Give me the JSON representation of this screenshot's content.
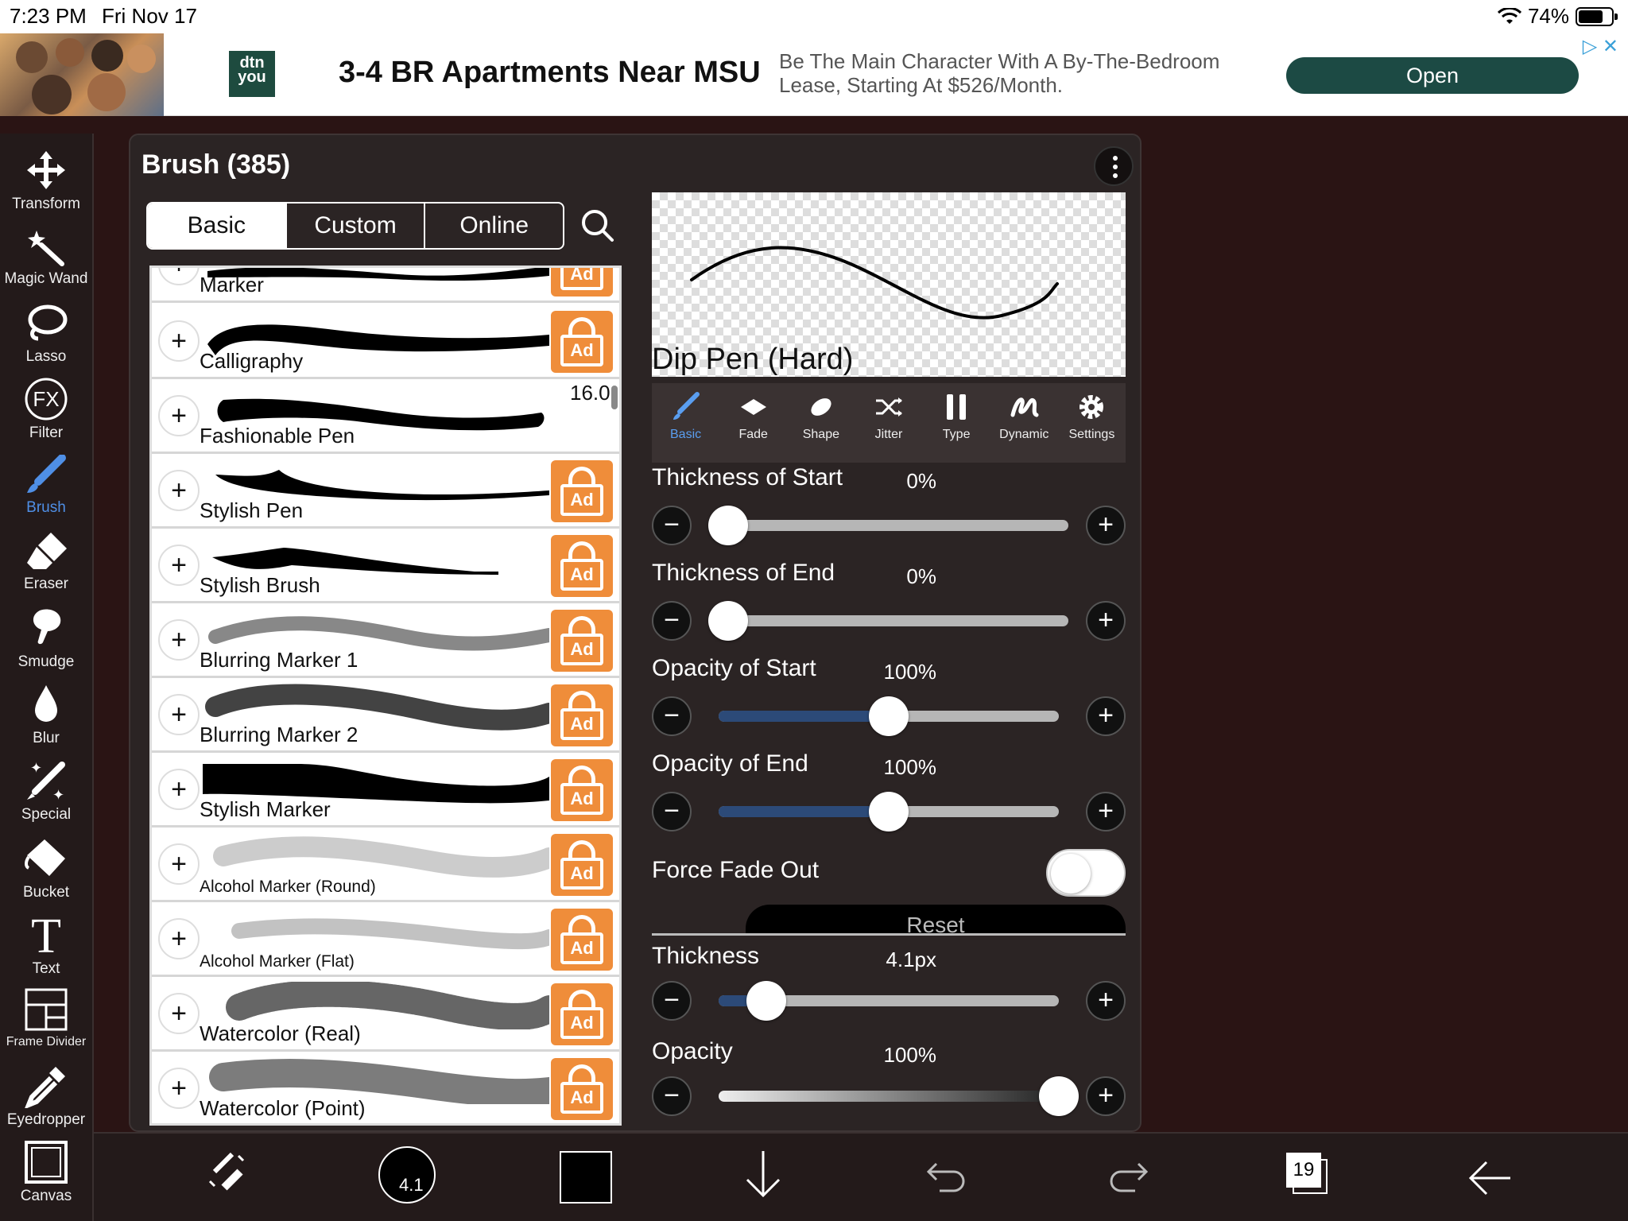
{
  "status": {
    "time": "7:23 PM",
    "date": "Fri Nov 17",
    "battery": "74%"
  },
  "ad": {
    "logo": "dtn you",
    "title": "3-4 BR Apartments Near MSU",
    "description": "Be The Main Character With A By-The-Bedroom Lease, Starting At $526/Month.",
    "button": "Open"
  },
  "tools": [
    {
      "label": "Transform",
      "icon": "move-icon"
    },
    {
      "label": "Magic Wand",
      "icon": "magic-wand-icon"
    },
    {
      "label": "Lasso",
      "icon": "lasso-icon"
    },
    {
      "label": "Filter",
      "icon": "fx-icon"
    },
    {
      "label": "Brush",
      "icon": "brush-icon",
      "active": true
    },
    {
      "label": "Eraser",
      "icon": "eraser-icon"
    },
    {
      "label": "Smudge",
      "icon": "smudge-icon"
    },
    {
      "label": "Blur",
      "icon": "drop-icon"
    },
    {
      "label": "Special",
      "icon": "special-icon"
    },
    {
      "label": "Bucket",
      "icon": "bucket-icon"
    },
    {
      "label": "Text",
      "icon": "text-icon"
    },
    {
      "label": "Frame Divider",
      "icon": "frame-divider-icon"
    },
    {
      "label": "Eyedropper",
      "icon": "eyedropper-icon"
    },
    {
      "label": "Canvas",
      "icon": "canvas-icon"
    }
  ],
  "panel": {
    "title": "Brush (385)",
    "tabs": [
      "Basic",
      "Custom",
      "Online"
    ],
    "selected_tab": "Basic",
    "brushes": [
      {
        "name": "Marker",
        "locked": true
      },
      {
        "name": "Calligraphy",
        "locked": true
      },
      {
        "name": "Fashionable Pen",
        "locked": false,
        "size": "16.0"
      },
      {
        "name": "Stylish Pen",
        "locked": true
      },
      {
        "name": "Stylish Brush",
        "locked": true
      },
      {
        "name": "Blurring Marker 1",
        "locked": true
      },
      {
        "name": "Blurring Marker 2",
        "locked": true
      },
      {
        "name": "Stylish Marker",
        "locked": true
      },
      {
        "name": "Alcohol Marker (Round)",
        "locked": true
      },
      {
        "name": "Alcohol Marker (Flat)",
        "locked": true
      },
      {
        "name": "Watercolor (Real)",
        "locked": true
      },
      {
        "name": "Watercolor (Point)",
        "locked": true
      }
    ],
    "lock_label": "Ad",
    "preview_name": "Dip Pen (Hard)",
    "prop_tabs": [
      "Basic",
      "Fade",
      "Shape",
      "Jitter",
      "Type",
      "Dynamic",
      "Settings"
    ],
    "selected_prop_tab": "Basic",
    "sliders": [
      {
        "label": "Thickness of Start",
        "value": "0%",
        "fraction": 0.0
      },
      {
        "label": "Thickness of End",
        "value": "0%",
        "fraction": 0.0
      },
      {
        "label": "Opacity of Start",
        "value": "100%",
        "fraction": 0.5
      },
      {
        "label": "Opacity of End",
        "value": "100%",
        "fraction": 0.5
      }
    ],
    "force_fade_out": {
      "label": "Force Fade Out",
      "on": false
    },
    "reset_label": "Reset",
    "thickness": {
      "label": "Thickness",
      "value": "4.1px",
      "fraction": 0.14
    },
    "opacity": {
      "label": "Opacity",
      "value": "100%",
      "fraction": 1.0
    }
  },
  "bottom": {
    "brush_size": "4.1",
    "layers_count": "19",
    "color": "#000000"
  }
}
